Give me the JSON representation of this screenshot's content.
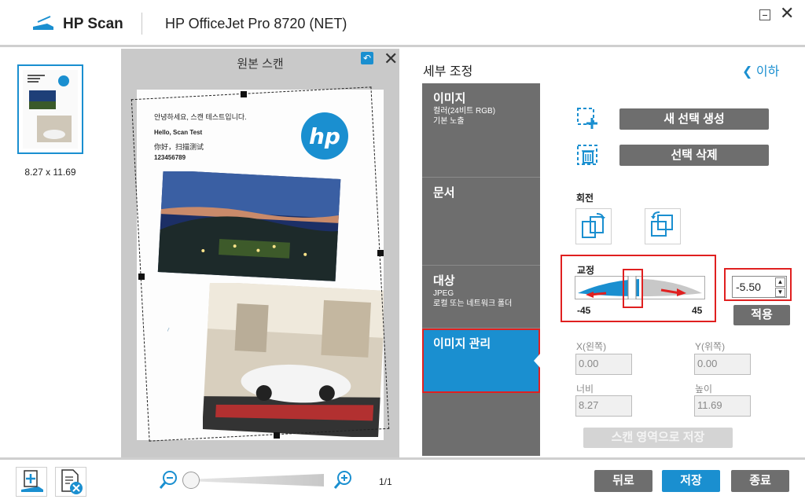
{
  "titlebar": {
    "app_name": "HP Scan",
    "device_name": "HP OfficeJet Pro 8720 (NET)"
  },
  "thumbnail": {
    "size_label": "8.27  x  11.69"
  },
  "preview": {
    "title": "원본 스캔",
    "page_text": {
      "line1": "안녕하세요, 스캔 테스트입니다.",
      "line2": "Hello, Scan Test",
      "line3": "你好，扫描测试",
      "line4": "123456789"
    }
  },
  "detail": {
    "title": "세부 조정",
    "back_label": "이하"
  },
  "nav": {
    "items": [
      {
        "title": "이미지",
        "sub1": "컬러(24비트 RGB)",
        "sub2": "기본 노출"
      },
      {
        "title": "문서",
        "sub1": "",
        "sub2": ""
      },
      {
        "title": "대상",
        "sub1": "JPEG",
        "sub2": "로컬 또는 네트워크 폴더"
      }
    ],
    "active_label": "이미지 관리"
  },
  "pane": {
    "new_selection": "새 선택 생성",
    "delete_selection": "선택 삭제",
    "rotate_label": "회전",
    "straighten_label": "교정",
    "slider_min": "-45",
    "slider_max": "45",
    "angle_value": "-5.50",
    "apply_label": "적용",
    "x_label": "X(왼쪽)",
    "y_label": "Y(위쪽)",
    "x_value": "0.00",
    "y_value": "0.00",
    "width_label": "너비",
    "height_label": "높이",
    "width_value": "8.27",
    "height_value": "11.69",
    "save_region_label": "스캔 영역으로 저장"
  },
  "bottombar": {
    "page_count": "1/1",
    "back_label": "뒤로",
    "save_label": "저장",
    "exit_label": "종료"
  },
  "colors": {
    "accent": "#1a8fd0",
    "nav_gray": "#6e6e6e",
    "highlight_red": "#e02020"
  }
}
